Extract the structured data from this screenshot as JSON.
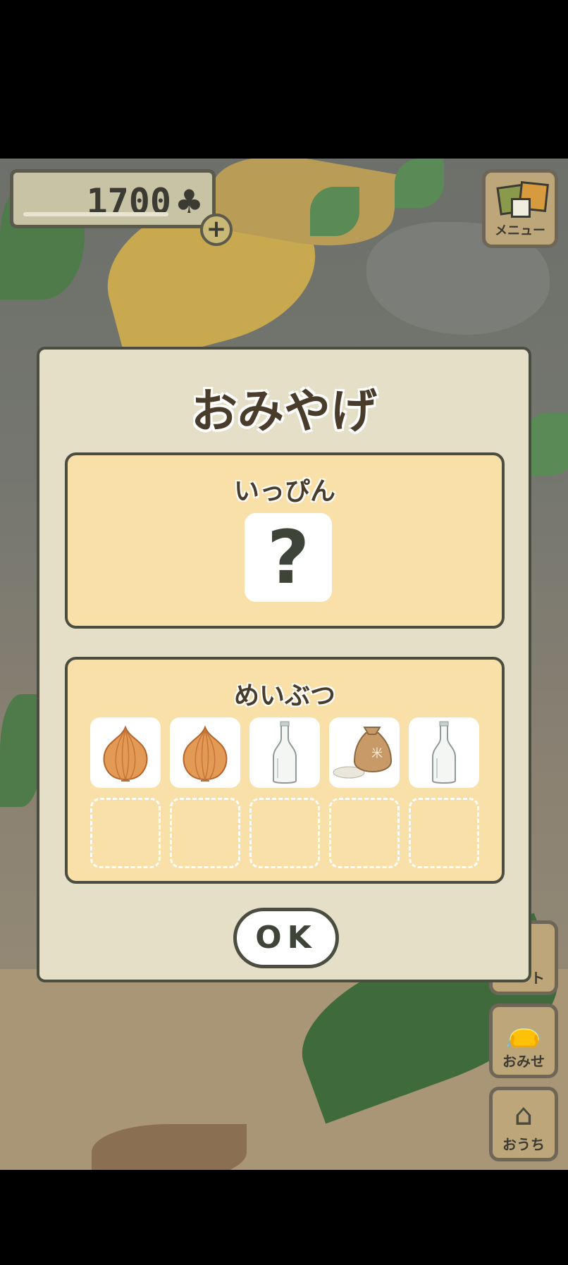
{
  "coins": {
    "amount": "1700",
    "clover_icon": "clover-icon",
    "add_icon": "plus-icon"
  },
  "menu": {
    "label": "メニュー",
    "icon": "menu-squares-icon"
  },
  "side_buttons": [
    {
      "label": "ト",
      "icon": "partial-button-icon"
    },
    {
      "label": "おみせ",
      "icon": "shop-bags-icon"
    },
    {
      "label": "おうち",
      "icon": "house-icon"
    }
  ],
  "dialog": {
    "title": "おみやげ",
    "rare_section": {
      "title": "いっぴん",
      "item": "?"
    },
    "local_section": {
      "title": "めいぶつ",
      "items": [
        {
          "name": "onion-icon"
        },
        {
          "name": "onion-icon"
        },
        {
          "name": "bottle-icon"
        },
        {
          "name": "rice-bag-icon"
        },
        {
          "name": "bottle-icon"
        }
      ],
      "empty_slots": 5
    },
    "ok_label": "OK"
  }
}
